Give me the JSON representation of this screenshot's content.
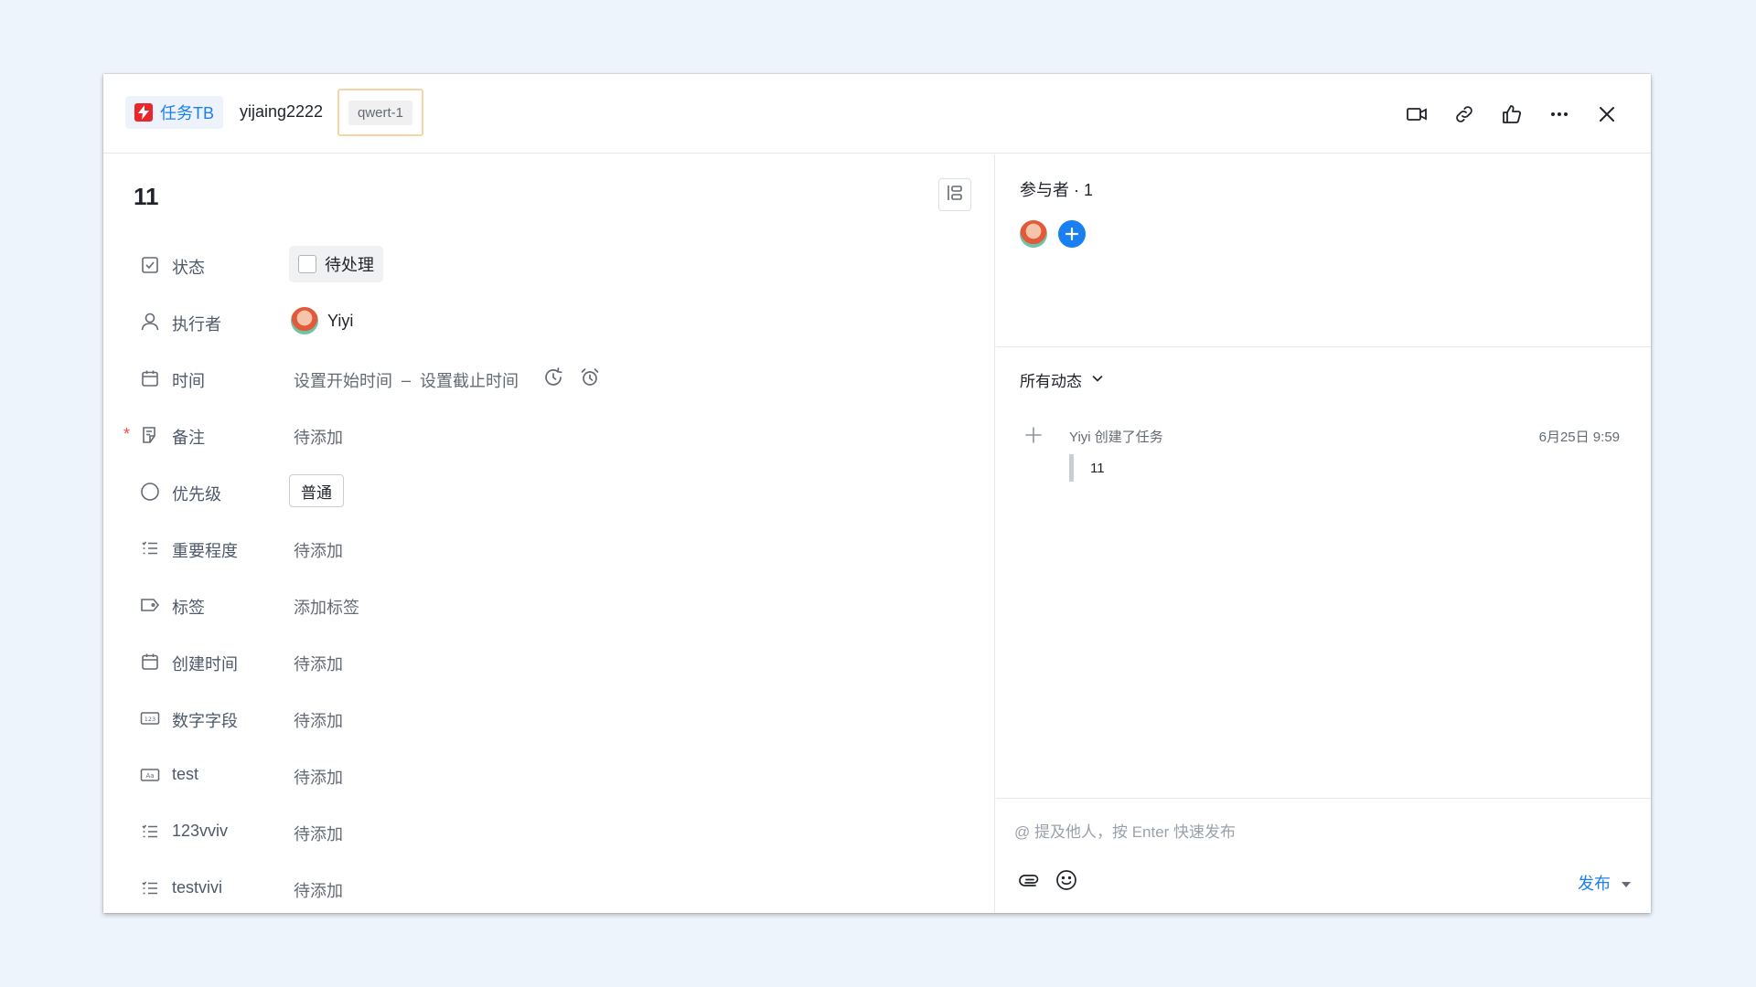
{
  "header": {
    "project_name": "任务TB",
    "org_name": "yijaing2222",
    "task_id": "qwert-1",
    "icons": [
      "video-icon",
      "link-icon",
      "thumbs-up-icon",
      "more-icon",
      "close-icon"
    ]
  },
  "task": {
    "title": "11",
    "fields": {
      "status": {
        "label": "状态",
        "value": "待处理"
      },
      "assignee": {
        "label": "执行者",
        "value": "Yiyi"
      },
      "time": {
        "label": "时间",
        "start": "设置开始时间",
        "separator": "–",
        "end": "设置截止时间"
      },
      "note": {
        "label": "备注",
        "value": "待添加",
        "required_mark": "*"
      },
      "priority": {
        "label": "优先级",
        "value": "普通"
      },
      "importance": {
        "label": "重要程度",
        "value": "待添加"
      },
      "tags": {
        "label": "标签",
        "value": "添加标签"
      },
      "created": {
        "label": "创建时间",
        "value": "待添加"
      },
      "number": {
        "label": "数字字段",
        "value": "待添加"
      },
      "test": {
        "label": "test",
        "value": "待添加"
      },
      "vviv": {
        "label": "123vviv",
        "value": "待添加"
      },
      "testvivi": {
        "label": "testvivi",
        "value": "待添加"
      }
    }
  },
  "sidebar": {
    "members_title": "参与者 · 1",
    "activity_filter": "所有动态",
    "activities": [
      {
        "text": "Yiyi 创建了任务",
        "time": "6月25日 9:59",
        "quote": "11"
      }
    ],
    "composer": {
      "placeholder": "@ 提及他人，按 Enter 快速发布",
      "publish_label": "发布"
    }
  },
  "colors": {
    "accent": "#1a7ff0",
    "brand_red": "#e8262b",
    "background": "#eef4fc",
    "required": "#f54a45"
  }
}
